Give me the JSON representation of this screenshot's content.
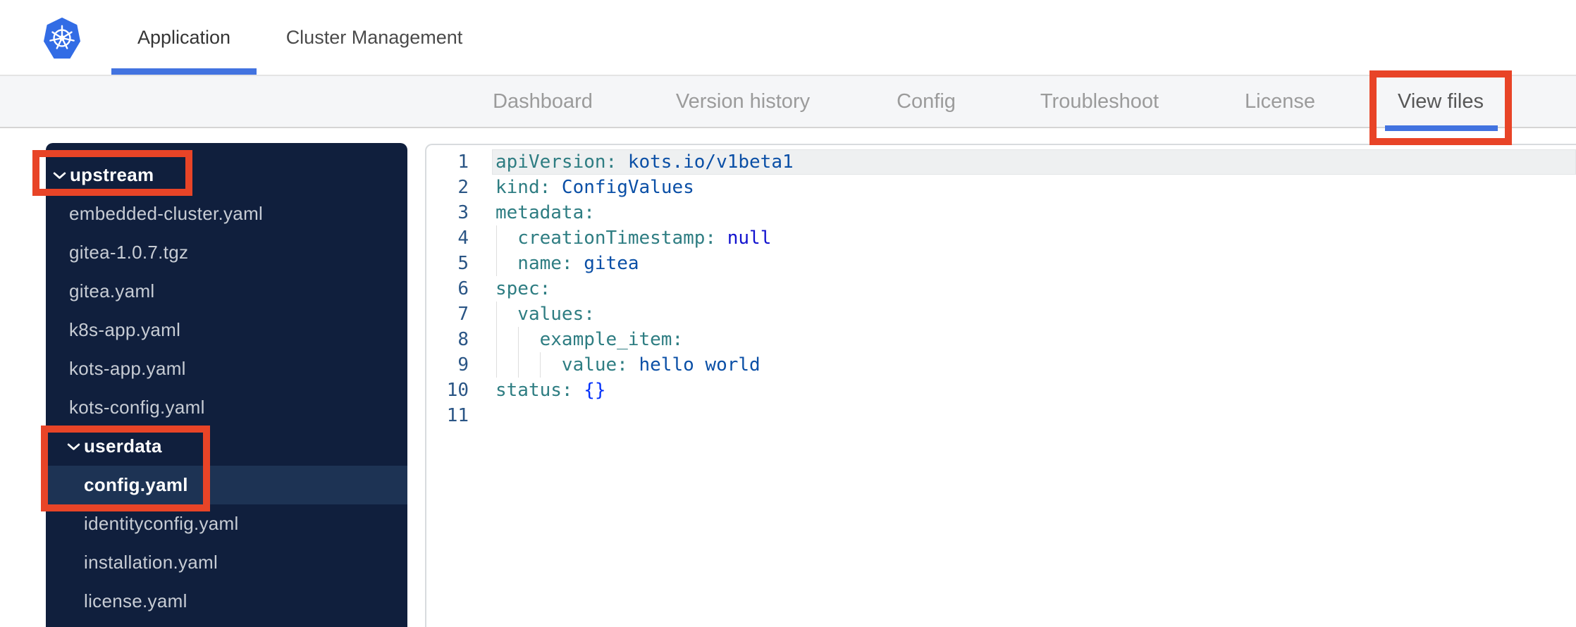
{
  "topbar": {
    "tabs": [
      {
        "label": "Application",
        "active": true
      },
      {
        "label": "Cluster Management",
        "active": false
      }
    ]
  },
  "subnav": {
    "items": [
      {
        "label": "Dashboard",
        "active": false
      },
      {
        "label": "Version history",
        "active": false
      },
      {
        "label": "Config",
        "active": false
      },
      {
        "label": "Troubleshoot",
        "active": false
      },
      {
        "label": "License",
        "active": false
      },
      {
        "label": "View files",
        "active": true
      }
    ]
  },
  "sidebar": {
    "tree": [
      {
        "label": "upstream",
        "type": "folder",
        "level": 0,
        "expanded": true
      },
      {
        "label": "embedded-cluster.yaml",
        "type": "file",
        "level": 0
      },
      {
        "label": "gitea-1.0.7.tgz",
        "type": "file",
        "level": 0
      },
      {
        "label": "gitea.yaml",
        "type": "file",
        "level": 0
      },
      {
        "label": "k8s-app.yaml",
        "type": "file",
        "level": 0
      },
      {
        "label": "kots-app.yaml",
        "type": "file",
        "level": 0
      },
      {
        "label": "kots-config.yaml",
        "type": "file",
        "level": 0
      },
      {
        "label": "userdata",
        "type": "folder",
        "level": 1,
        "expanded": true
      },
      {
        "label": "config.yaml",
        "type": "file",
        "level": 1,
        "selected": true
      },
      {
        "label": "identityconfig.yaml",
        "type": "file",
        "level": 1
      },
      {
        "label": "installation.yaml",
        "type": "file",
        "level": 1
      },
      {
        "label": "license.yaml",
        "type": "file",
        "level": 1
      }
    ]
  },
  "editor": {
    "lines": [
      {
        "num": "1",
        "current": true,
        "guides": 0,
        "tokens": [
          {
            "c": "key",
            "v": "apiVersion:"
          },
          {
            "c": "str",
            "v": " kots.io/v1beta1"
          }
        ]
      },
      {
        "num": "2",
        "guides": 0,
        "tokens": [
          {
            "c": "key",
            "v": "kind:"
          },
          {
            "c": "str",
            "v": " ConfigValues"
          }
        ]
      },
      {
        "num": "3",
        "guides": 0,
        "tokens": [
          {
            "c": "key",
            "v": "metadata:"
          }
        ]
      },
      {
        "num": "4",
        "guides": 1,
        "tokens": [
          {
            "c": "key",
            "v": "  creationTimestamp:"
          },
          {
            "c": "kw",
            "v": " null"
          }
        ]
      },
      {
        "num": "5",
        "guides": 1,
        "tokens": [
          {
            "c": "key",
            "v": "  name:"
          },
          {
            "c": "str",
            "v": " gitea"
          }
        ]
      },
      {
        "num": "6",
        "guides": 0,
        "tokens": [
          {
            "c": "key",
            "v": "spec:"
          }
        ]
      },
      {
        "num": "7",
        "guides": 1,
        "tokens": [
          {
            "c": "key",
            "v": "  values:"
          }
        ]
      },
      {
        "num": "8",
        "guides": 2,
        "tokens": [
          {
            "c": "key",
            "v": "    example_item:"
          }
        ]
      },
      {
        "num": "9",
        "guides": 3,
        "tokens": [
          {
            "c": "key",
            "v": "      value:"
          },
          {
            "c": "str",
            "v": " hello world"
          }
        ]
      },
      {
        "num": "10",
        "guides": 0,
        "tokens": [
          {
            "c": "key",
            "v": "status:"
          },
          {
            "c": "punc",
            "v": " {}"
          }
        ]
      },
      {
        "num": "11",
        "guides": 0,
        "tokens": []
      }
    ]
  },
  "annotations": [
    {
      "target": "view-files-tab"
    },
    {
      "target": "upstream-folder"
    },
    {
      "target": "userdata-folder-and-config-yaml"
    }
  ],
  "icons": {
    "logo": "kubernetes-helm-wheel",
    "folder_chevron": "chevron-down"
  },
  "colors": {
    "accent_blue": "#4273e0",
    "kubernetes_blue": "#326ce5",
    "annotation_red": "#e84427",
    "sidebar_navy": "#101f3d",
    "selected_row_navy": "#1d3354",
    "yaml_key_teal": "#2e7d82",
    "yaml_value_blue": "#0a4fa6",
    "yaml_null_blue": "#1212cf",
    "yaml_brace_blue": "#0431fa",
    "line_number_blue": "#2a5585"
  }
}
